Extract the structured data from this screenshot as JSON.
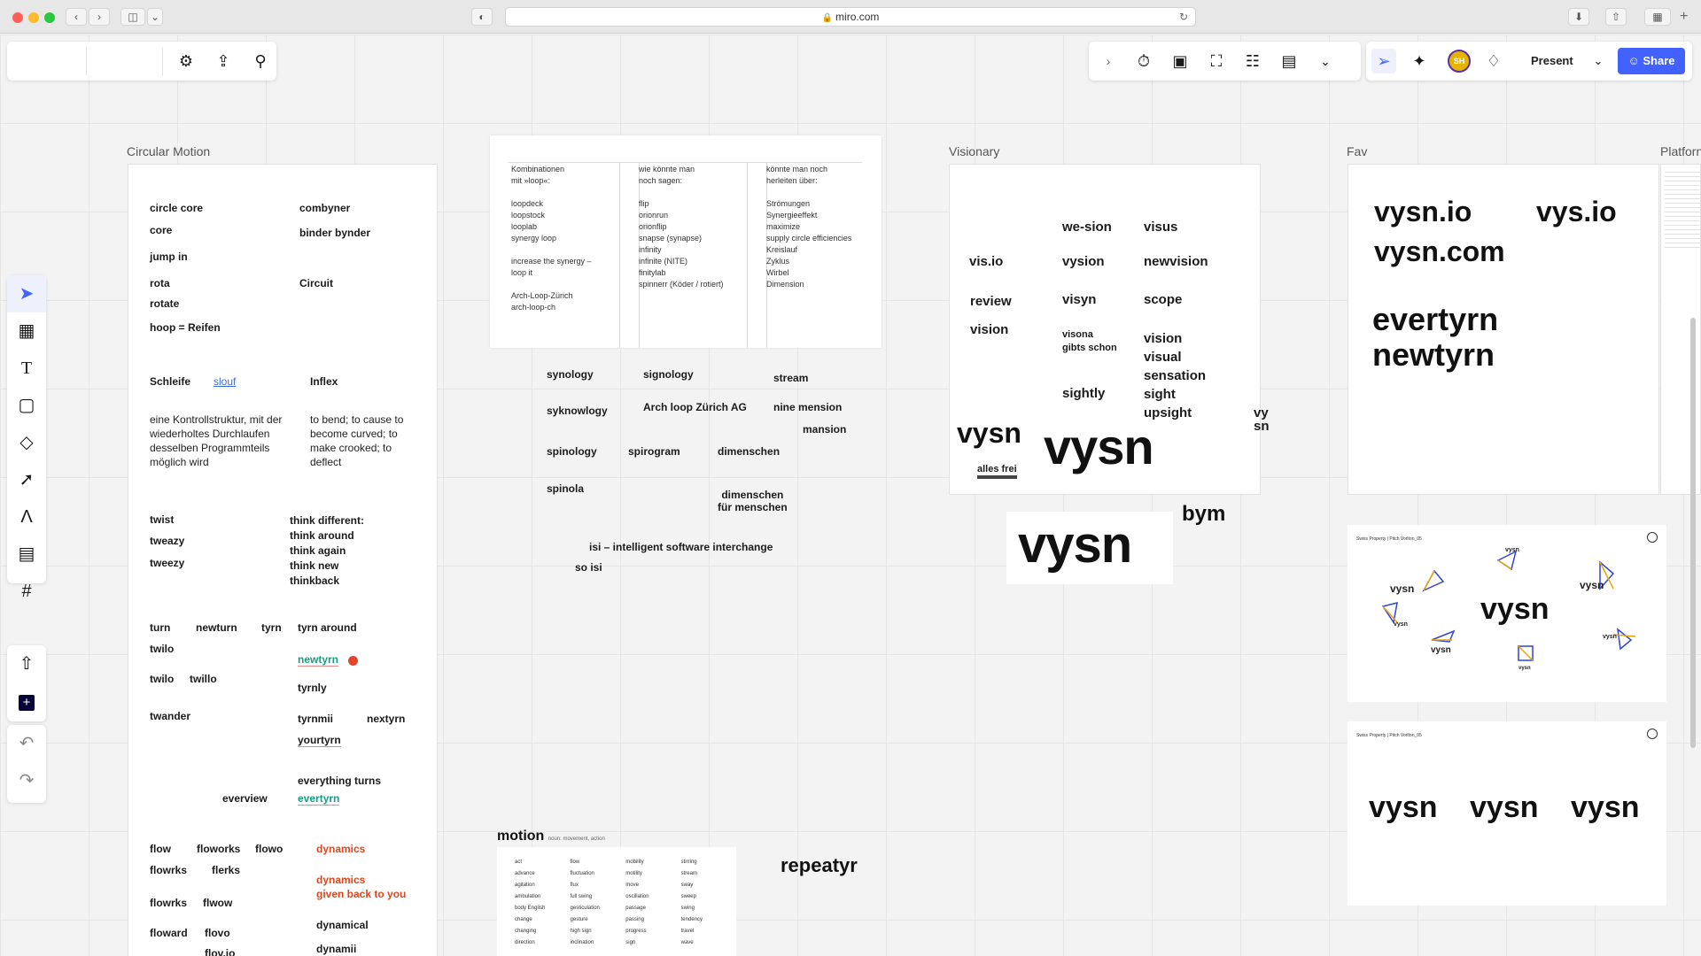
{
  "browser": {
    "url": "miro.com",
    "colors": {
      "close": "#fe5f57",
      "minimize": "#febb2e",
      "maximize": "#28c840"
    }
  },
  "toolbar_right": {
    "present_label": "Present",
    "share_label": "Share",
    "avatar_initials": "SH"
  },
  "frames": {
    "circular_motion": "Circular Motion",
    "visionary": "Visionary",
    "fav": "Fav",
    "platform": "Platforn"
  },
  "circular": {
    "circle_core": "circle core",
    "combyner": "combyner",
    "core": "core",
    "binder_bynder": "binder  bynder",
    "jump_in": "jump in",
    "rota": "rota",
    "circuit": "Circuit",
    "rotate": "rotate",
    "hoop": "hoop = Reifen",
    "schleife": "Schleife",
    "slouf": "slouf",
    "inflex": "Inflex",
    "schleife_def": "eine Kontrollstruktur, mit der wiederholtes Durchlaufen desselben Programmteils möglich wird",
    "inflex_def": "to bend; to cause to become curved; to make crooked; to deflect",
    "twist": "twist",
    "tweazy": "tweazy",
    "tweezy": "tweezy",
    "think_list": "think different:\nthink around\nthink again\nthink new\nthinkback",
    "turn": "turn",
    "newturn": "newturn",
    "tyrn": "tyrn",
    "tyrn_around": "tyrn around",
    "twilo": "twilo",
    "newtyrn": "newtyrn",
    "twilo2": "twilo",
    "twillo": "twillo",
    "tyrnly": "tyrnly",
    "twander": "twander",
    "tyrnmii": "tyrnmii",
    "nextyrn": "nextyrn",
    "yourtyrn": "yourtyrn",
    "everything_turns": "everything turns",
    "everview": "everview",
    "evertyrn": "evertyrn",
    "flow": "flow",
    "floworks": "floworks",
    "flowo": "flowo",
    "dynamics": "dynamics",
    "flowrks": "flowrks",
    "flerks": "flerks",
    "dynamics_back": "dynamics\ngiven back to you",
    "flowrks2": "flowrks",
    "flwow": "flwow",
    "dynamical": "dynamical",
    "floward": "floward",
    "flovo": "flovo",
    "dynamii": "dynamii",
    "flovio": "flov.io"
  },
  "kombi": {
    "col1": "Kombinationen\nmit »loop«:\n\nloopdeck\nloopstock\nlooplab\nsynergy loop\n\nincrease the synergy –\nloop it\n\nArch-Loop-Zürich\narch-loop-ch",
    "col2": "wie könnte man\nnoch sagen:\n\nflip\norionrun\norionflip\nsnapse (synapse)\ninfinity\ninfinite (NITE)\nfinitylab\nspinnerr (Köder / rotiert)",
    "col3": "könnte man noch\nherleiten über:\n\nStrömungen\nSynergieeffekt\nmaximize\nsupply circle efficiencies\nKreislauf\nZyklus\nWirbel\nDimension"
  },
  "middle": {
    "synology": "synology",
    "signology": "signology",
    "stream": "stream",
    "syknowlogy": "syknowlogy",
    "arch_loop": "Arch loop Zürich AG",
    "nine_mension": "nine mension",
    "mansion": "mansion",
    "spinology": "spinology",
    "spirogram": "spirogram",
    "dimenschen": "dimenschen",
    "spinola": "spinola",
    "dimenschen_menschen": "dimenschen\nfür menschen",
    "isi": "isi – intelligent software interchange",
    "so_isi": "so isi",
    "motion_title": "motion",
    "motion_sub": "noun: movement, action",
    "repeatyr": "repeatyr"
  },
  "motion_table": [
    [
      "act",
      "flow",
      "mobility",
      "stirring"
    ],
    [
      "advance",
      "fluctuation",
      "motility",
      "stream"
    ],
    [
      "agitation",
      "flux",
      "move",
      "sway"
    ],
    [
      "ambulation",
      "full swing",
      "oscillation",
      "sweep"
    ],
    [
      "body English",
      "gesticulation",
      "passage",
      "swing"
    ],
    [
      "change",
      "gesture",
      "passing",
      "tendency"
    ],
    [
      "changing",
      "high sign",
      "progress",
      "travel"
    ],
    [
      "direction",
      "inclination",
      "sign",
      "wave"
    ]
  ],
  "visionary": {
    "we_sion": "we-sion",
    "visus": "visus",
    "vis_io": "vis.io",
    "vysion": "vysion",
    "newvision": "newvision",
    "review": "review",
    "visyn": "visyn",
    "scope": "scope",
    "vision": "vision",
    "visona": "visona\ngibts schon",
    "vision_list": "vision\nvisual\nsensation\nsight\nupsight",
    "sightly": "sightly",
    "vysn_teal": "vysn",
    "alles_frei": "alles frei",
    "vysn_big": "vysn",
    "vy_sn": "vy\nsn",
    "vysn_card": "vysn",
    "bym": "bym"
  },
  "fav": {
    "vysn_io": "vysn.io",
    "vys_io": "vys.io",
    "vysn_com": "vysn.com",
    "evertyrn": "evertyrn",
    "newtyrn": "newtyrn"
  },
  "logo_card1": {
    "header": "Swiss Property | Pitch Vorlton_05",
    "word": "vysn",
    "small_words": [
      "vysn",
      "vysn",
      "vysn",
      "vysn",
      "vysn",
      "vysn",
      "vysn"
    ]
  },
  "logo_card2": {
    "header": "Swiss Property | Pitch Vorlton_05",
    "words": [
      "vysn",
      "vysn",
      "vysn"
    ]
  }
}
